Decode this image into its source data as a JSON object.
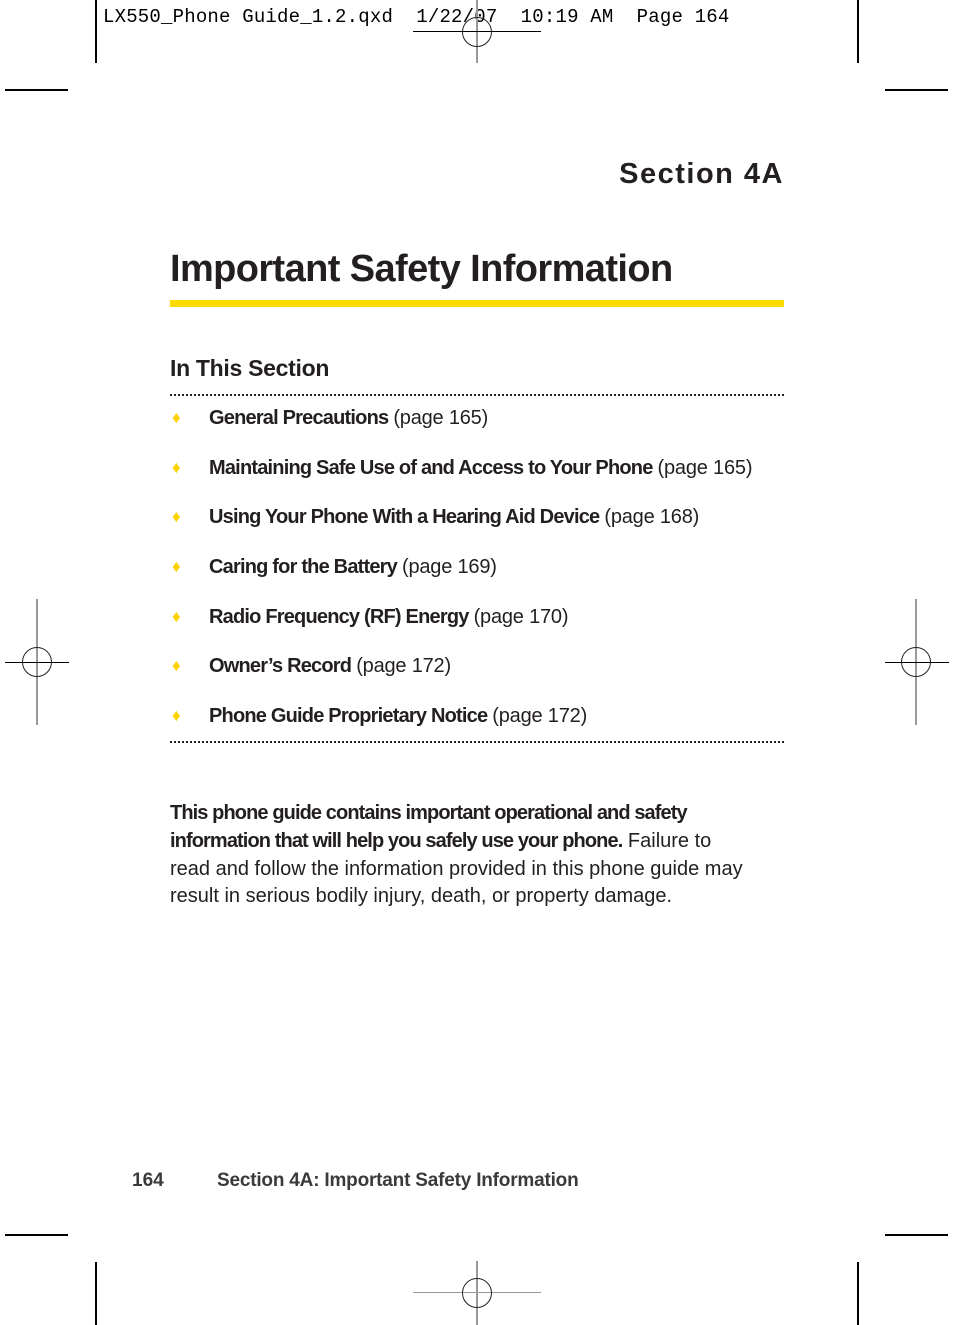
{
  "slug_line": "LX550_Phone Guide_1.2.qxd  1/22/07  10:19 AM  Page 164",
  "section_label": "Section 4A",
  "page_title": "Important Safety Information",
  "in_this_section": {
    "heading": "In This Section",
    "bullet_icon": "diamond",
    "items": [
      {
        "title": "General Precautions",
        "page": "(page 165)"
      },
      {
        "title": "Maintaining Safe Use of and Access to Your Phone",
        "page": "(page 165)"
      },
      {
        "title": "Using Your Phone With a Hearing Aid Device",
        "page": "(page 168)"
      },
      {
        "title": "Caring for the Battery",
        "page": "(page 169)"
      },
      {
        "title": "Radio Frequency (RF) Energy",
        "page": "(page 170)"
      },
      {
        "title": "Owner’s Record",
        "page": "(page 172)"
      },
      {
        "title": "Phone Guide Proprietary Notice",
        "page": "(page 172)"
      }
    ]
  },
  "intro": {
    "bold": "This phone guide contains important operational and safety information that will help you safely use your phone.",
    "normal": " Failure to read and follow the information provided in this phone guide may result in serious bodily injury, death, or property damage."
  },
  "footer": {
    "page_number": "164",
    "running_title": "Section 4A: Important Safety Information"
  },
  "colors": {
    "accent_yellow": "#fcdc00",
    "text": "#231f20"
  }
}
